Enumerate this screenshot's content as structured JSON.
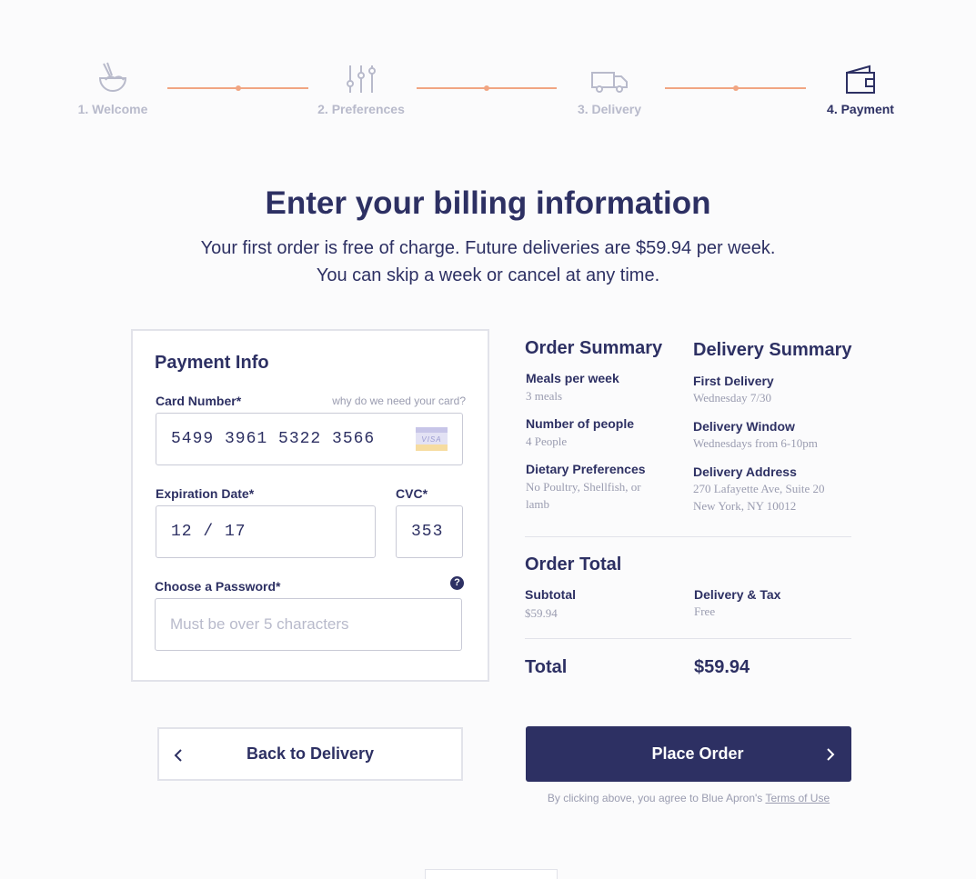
{
  "colors": {
    "primary": "#2d3063",
    "accent": "#f1a582",
    "muted": "#b8bacb"
  },
  "steps": [
    {
      "label": "1. Welcome",
      "icon": "bowl-icon"
    },
    {
      "label": "2. Preferences",
      "icon": "sliders-icon"
    },
    {
      "label": "3. Delivery",
      "icon": "truck-icon"
    },
    {
      "label": "4. Payment",
      "icon": "wallet-icon",
      "active": true
    }
  ],
  "heading": {
    "title": "Enter your billing information",
    "line1": "Your first order is free of charge. Future deliveries are $59.94 per week.",
    "line2": "You can skip a week or cancel at any time."
  },
  "payment": {
    "title": "Payment Info",
    "card_label": "Card Number",
    "required_mark": "*",
    "why_link": "why do we need your card?",
    "card_value": "5499 3961 5322 3566",
    "card_brand": "VISA",
    "exp_label": "Expiration Date",
    "exp_value": "12 / 17",
    "cvc_label": "CVC",
    "cvc_value": "353",
    "password_label": "Choose a Password",
    "password_placeholder": "Must be over 5 characters",
    "help_icon": "?"
  },
  "order_summary": {
    "title": "Order Summary",
    "items": [
      {
        "label": "Meals per week",
        "value": "3 meals"
      },
      {
        "label": "Number of people",
        "value": "4 People"
      },
      {
        "label": "Dietary Preferences",
        "value": "No Poultry, Shellfish, or lamb"
      }
    ]
  },
  "delivery_summary": {
    "title": "Delivery Summary",
    "items": [
      {
        "label": "First Delivery",
        "value": "Wednesday 7/30"
      },
      {
        "label": "Delivery Window",
        "value": "Wednesdays from 6-10pm"
      },
      {
        "label": "Delivery Address",
        "value": "270 Lafayette Ave, Suite 20",
        "value2": "New York, NY 10012"
      }
    ]
  },
  "order_total": {
    "title": "Order Total",
    "subtotal_label": "Subtotal",
    "subtotal_value": "$59.94",
    "delivery_label": "Delivery & Tax",
    "delivery_value": "Free",
    "total_label": "Total",
    "total_value": "$59.94"
  },
  "actions": {
    "back_label": "Back to Delivery",
    "place_label": "Place Order",
    "terms_text": "By clicking above, you agree to Blue Apron's",
    "terms_link": "Terms of Use"
  }
}
